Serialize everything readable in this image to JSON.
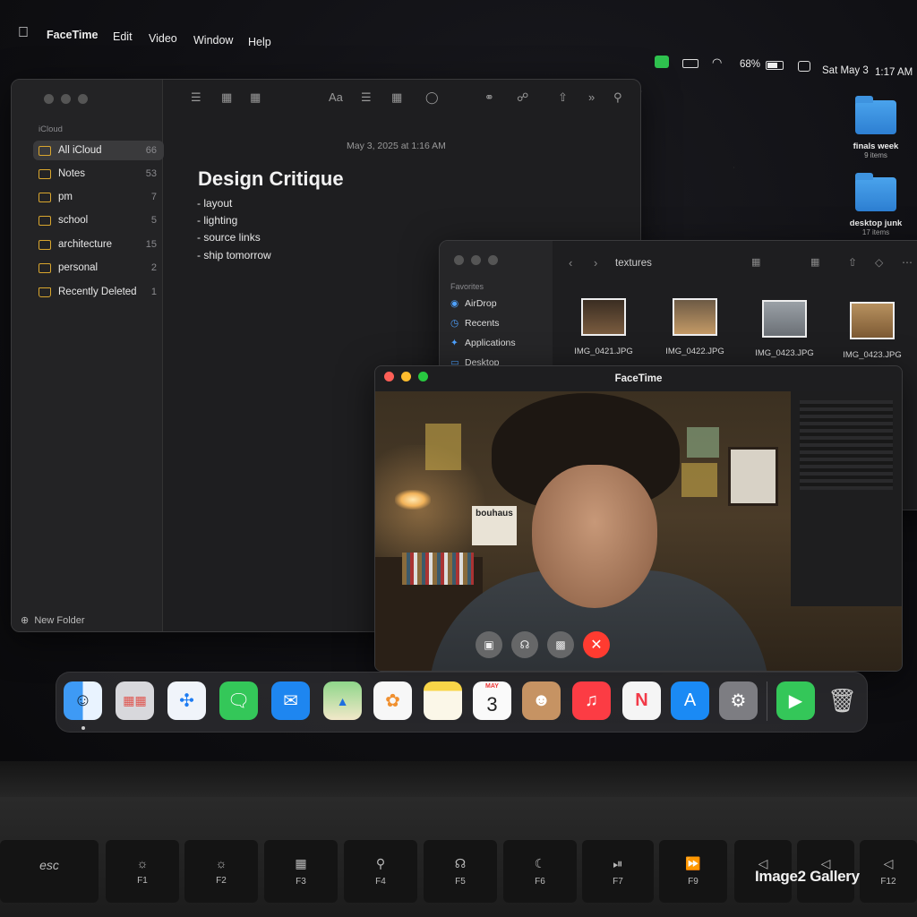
{
  "menubar": {
    "apple": "",
    "app": "FaceTime",
    "items": [
      "Edit",
      "Video",
      "Window",
      "Help"
    ]
  },
  "status": {
    "battery": "68%",
    "date": "Sat May 3",
    "time": "1:17 AM"
  },
  "desktop": [
    {
      "name": "finals week",
      "count": "9 items"
    },
    {
      "name": "desktop junk",
      "count": "17 items"
    }
  ],
  "notes": {
    "sidebar_header": "iCloud",
    "folders": [
      {
        "label": "All iCloud",
        "count": "66"
      },
      {
        "label": "Notes",
        "count": "53"
      },
      {
        "label": "pm",
        "count": "7"
      },
      {
        "label": "school",
        "count": "5"
      },
      {
        "label": "architecture",
        "count": "15"
      },
      {
        "label": "personal",
        "count": "2"
      },
      {
        "label": "Recently Deleted",
        "count": "1"
      }
    ],
    "new_folder": "New Folder",
    "toolbar_format": "Aa",
    "date": "May 3, 2025 at 1:16 AM",
    "title": "Design Critique",
    "lines": [
      "- layout",
      "- lighting",
      "- source links",
      "- ship tomorrow"
    ]
  },
  "finder": {
    "path": "textures",
    "sidebar_header": "Favorites",
    "sidebar": [
      "AirDrop",
      "Recents",
      "Applications",
      "Desktop"
    ],
    "files": [
      "IMG_0421.JPG",
      "IMG_0422.JPG",
      "IMG_0423.JPG",
      "IMG_0423.JPG"
    ]
  },
  "facetime": {
    "title": "FaceTime",
    "poster_text": "bouhaus"
  },
  "dock": {
    "apps": [
      "Finder",
      "Launchpad",
      "Safari",
      "Messages",
      "Mail",
      "Maps",
      "Photos",
      "Notes",
      "Calendar",
      "Contacts",
      "Music",
      "News",
      "App Store",
      "System Settings",
      "FaceTime",
      "Trash"
    ],
    "calendar_month": "MAY",
    "calendar_day": "3"
  },
  "keyboard": {
    "esc": "esc",
    "fkeys": [
      "F1",
      "F2",
      "F3",
      "F4",
      "F5",
      "F6",
      "F7",
      "F9",
      "F12"
    ]
  },
  "watermark": "Image2 Gallery",
  "colors": {
    "facetime_green": "#2fc24f",
    "end_call_red": "#ff3b30",
    "folder_yellow": "#d9a62e",
    "folder_blue": "#3e93df"
  }
}
